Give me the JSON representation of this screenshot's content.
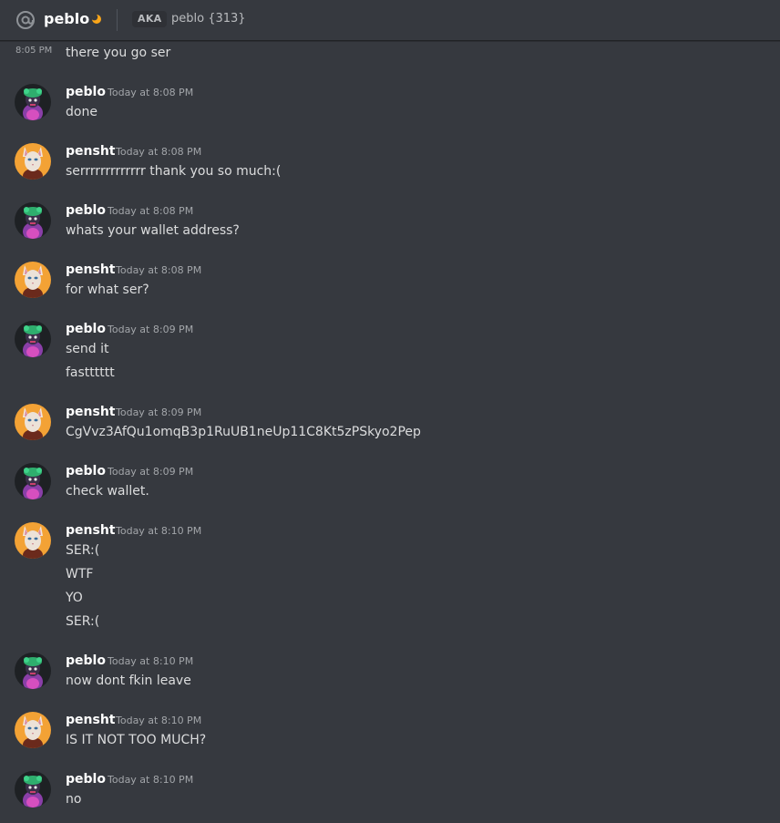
{
  "header": {
    "name": "peblo",
    "aka_badge": "AKA",
    "aka_value": "peblo {313}",
    "status_icon": "moon-idle-icon"
  },
  "first_message": {
    "time": "8:05 PM",
    "text": "there you go ser"
  },
  "messages": [
    {
      "author": "peblo",
      "time": "Today at 8:08 PM",
      "lines": [
        "done"
      ]
    },
    {
      "author": "pensht",
      "time": "Today at 8:08 PM",
      "lines": [
        "serrrrrrrrrrrrr thank you so much:("
      ]
    },
    {
      "author": "peblo",
      "time": "Today at 8:08 PM",
      "lines": [
        "whats your wallet address?"
      ]
    },
    {
      "author": "pensht",
      "time": "Today at 8:08 PM",
      "lines": [
        "for what ser?"
      ]
    },
    {
      "author": "peblo",
      "time": "Today at 8:09 PM",
      "lines": [
        "send it",
        "fastttttt"
      ]
    },
    {
      "author": "pensht",
      "time": "Today at 8:09 PM",
      "lines": [
        "CgVvz3AfQu1omqB3p1RuUB1neUp11C8Kt5zPSkyo2Pep"
      ]
    },
    {
      "author": "peblo",
      "time": "Today at 8:09 PM",
      "lines": [
        "check wallet."
      ]
    },
    {
      "author": "pensht",
      "time": "Today at 8:10 PM",
      "lines": [
        "SER:(",
        "WTF",
        "YO",
        "SER:("
      ]
    },
    {
      "author": "peblo",
      "time": "Today at 8:10 PM",
      "lines": [
        "now dont fkin leave"
      ]
    },
    {
      "author": "pensht",
      "time": "Today at 8:10 PM",
      "lines": [
        "IS IT NOT TOO MUCH?"
      ]
    },
    {
      "author": "peblo",
      "time": "Today at 8:10 PM",
      "lines": [
        "no"
      ]
    }
  ]
}
